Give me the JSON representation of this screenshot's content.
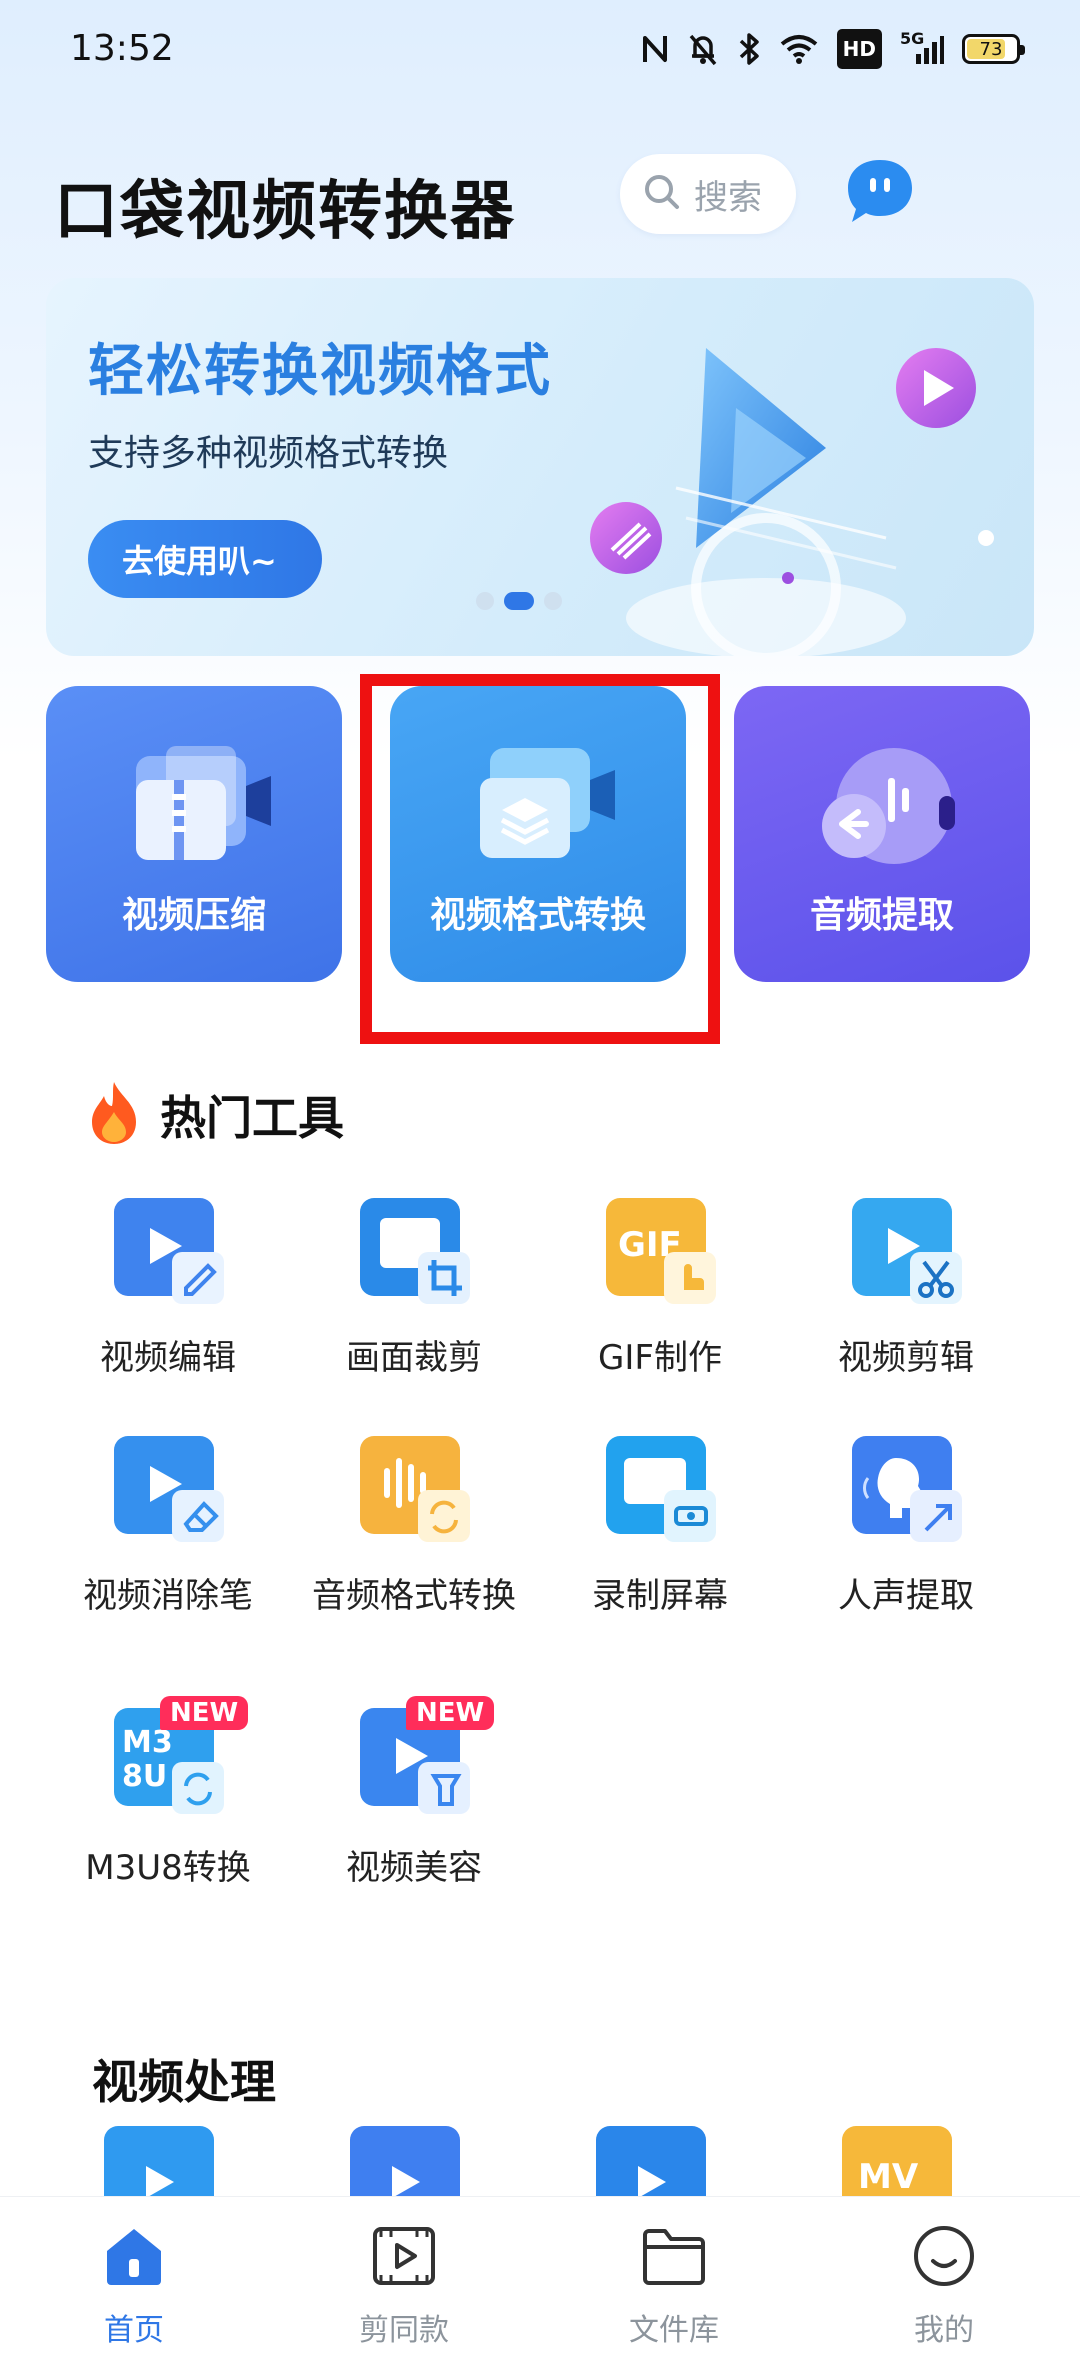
{
  "status_bar": {
    "time": "13:52",
    "network_label": "5G",
    "hd_label": "HD",
    "battery": "73",
    "icons": [
      "nfc-icon",
      "mute-icon",
      "bluetooth-icon",
      "wifi-icon",
      "hd-icon",
      "signal-icon",
      "battery-icon"
    ]
  },
  "header": {
    "title": "口袋视频转换器",
    "search_placeholder": "搜索"
  },
  "banner": {
    "title": "轻松转换视频格式",
    "subtitle": "支持多种视频格式转换",
    "button_label": "去使用叭~",
    "page_count": 3,
    "active_page": 2
  },
  "features": [
    {
      "label": "视频压缩",
      "icon": "zip-video-icon"
    },
    {
      "label": "视频格式转换",
      "icon": "layers-video-icon"
    },
    {
      "label": "音频提取",
      "icon": "audio-extract-icon"
    }
  ],
  "hot_tools": {
    "title": "热门工具",
    "items": [
      {
        "label": "视频编辑",
        "icon": "video-edit-icon"
      },
      {
        "label": "画面裁剪",
        "icon": "crop-icon"
      },
      {
        "label": "GIF制作",
        "icon": "gif-icon"
      },
      {
        "label": "视频剪辑",
        "icon": "video-cut-icon"
      },
      {
        "label": "视频消除笔",
        "icon": "eraser-icon"
      },
      {
        "label": "音频格式转换",
        "icon": "audio-convert-icon"
      },
      {
        "label": "录制屏幕",
        "icon": "screen-record-icon"
      },
      {
        "label": "人声提取",
        "icon": "voice-extract-icon"
      },
      {
        "label": "M3U8转换",
        "icon": "m3u8-icon",
        "badge": "NEW"
      },
      {
        "label": "视频美容",
        "icon": "video-beauty-icon",
        "badge": "NEW"
      }
    ]
  },
  "video_processing": {
    "title": "视频处理"
  },
  "bottom_nav": [
    {
      "label": "首页",
      "active": true,
      "icon": "home-icon"
    },
    {
      "label": "剪同款",
      "active": false,
      "icon": "film-icon"
    },
    {
      "label": "文件库",
      "active": false,
      "icon": "folder-icon"
    },
    {
      "label": "我的",
      "active": false,
      "icon": "smile-icon"
    }
  ],
  "colors": {
    "accent": "#2f77e6",
    "highlight": "#ee1111",
    "new_badge": "#ff2d5a"
  }
}
